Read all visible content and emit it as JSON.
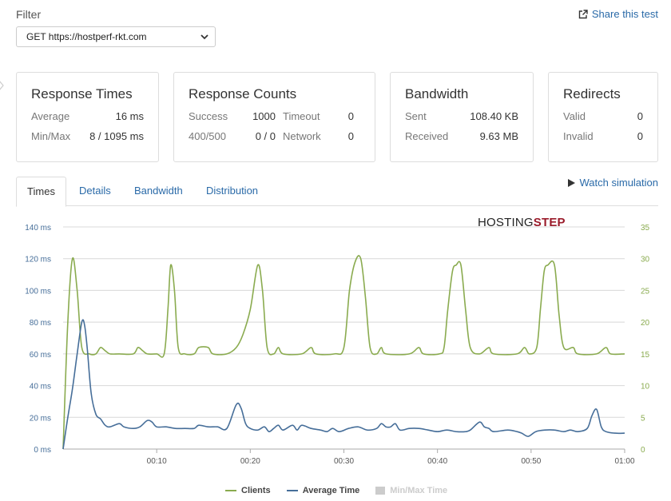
{
  "filter": {
    "label": "Filter",
    "selected": "GET https://hostperf-rkt.com"
  },
  "share_link": "Share this test",
  "cards": {
    "response_times": {
      "title": "Response Times",
      "average_label": "Average",
      "average_value": "16 ms",
      "minmax_label": "Min/Max",
      "minmax_value": "8 / 1095 ms"
    },
    "response_counts": {
      "title": "Response Counts",
      "success_label": "Success",
      "success_value": "1000",
      "timeout_label": "Timeout",
      "timeout_value": "0",
      "err_label": "400/500",
      "err_value": "0 / 0",
      "network_label": "Network",
      "network_value": "0"
    },
    "bandwidth": {
      "title": "Bandwidth",
      "sent_label": "Sent",
      "sent_value": "108.40 KB",
      "received_label": "Received",
      "received_value": "9.63 MB"
    },
    "redirects": {
      "title": "Redirects",
      "valid_label": "Valid",
      "valid_value": "0",
      "invalid_label": "Invalid",
      "invalid_value": "0"
    }
  },
  "tabs": [
    "Times",
    "Details",
    "Bandwidth",
    "Distribution"
  ],
  "watch_simulation": "Watch simulation",
  "logo": {
    "part1": "HOSTING",
    "part2": "STEP"
  },
  "colors": {
    "clients": "#8aab4f",
    "average": "#466e99",
    "minmax": "#cccccc",
    "link": "#2a6aa8"
  },
  "chart_data": {
    "type": "line",
    "x_ticks": [
      "00:10",
      "00:20",
      "00:30",
      "00:40",
      "00:50",
      "01:00"
    ],
    "y_left_ticks": [
      "0 ms",
      "20 ms",
      "40 ms",
      "60 ms",
      "80 ms",
      "100 ms",
      "120 ms",
      "140 ms"
    ],
    "y_right_ticks": [
      "0",
      "5",
      "10",
      "15",
      "20",
      "25",
      "30",
      "35"
    ],
    "xlim_seconds": [
      0,
      60
    ],
    "y_left_lim": [
      0,
      140
    ],
    "y_right_lim": [
      0,
      35
    ],
    "grid": true,
    "legend_position": "bottom",
    "series": [
      {
        "name": "Clients",
        "axis": "right",
        "points": [
          [
            0,
            0
          ],
          [
            0.5,
            20
          ],
          [
            1,
            30
          ],
          [
            1.5,
            25
          ],
          [
            2,
            16
          ],
          [
            2.8,
            15
          ],
          [
            3.5,
            15
          ],
          [
            4,
            16
          ],
          [
            4.5,
            15.5
          ],
          [
            5,
            15
          ],
          [
            6,
            15
          ],
          [
            7.5,
            15
          ],
          [
            8,
            16
          ],
          [
            8.5,
            15.5
          ],
          [
            9,
            15
          ],
          [
            10,
            15
          ],
          [
            10.8,
            15
          ],
          [
            11.2,
            22
          ],
          [
            11.5,
            29
          ],
          [
            11.9,
            25
          ],
          [
            12.3,
            16
          ],
          [
            13,
            15
          ],
          [
            14,
            15
          ],
          [
            14.5,
            16
          ],
          [
            15.5,
            16
          ],
          [
            16,
            15
          ],
          [
            17.5,
            15
          ],
          [
            18.5,
            16
          ],
          [
            19.2,
            18
          ],
          [
            20,
            22
          ],
          [
            20.8,
            29
          ],
          [
            21.3,
            25
          ],
          [
            21.8,
            16
          ],
          [
            22.5,
            15
          ],
          [
            23,
            16
          ],
          [
            23.5,
            15
          ],
          [
            25.5,
            15
          ],
          [
            26.5,
            16
          ],
          [
            27,
            15
          ],
          [
            29,
            15
          ],
          [
            30,
            16
          ],
          [
            30.6,
            25
          ],
          [
            31.2,
            29.5
          ],
          [
            31.8,
            30
          ],
          [
            32.3,
            24
          ],
          [
            32.8,
            16
          ],
          [
            33.5,
            15
          ],
          [
            34,
            16
          ],
          [
            34.5,
            15
          ],
          [
            37,
            15
          ],
          [
            38,
            16
          ],
          [
            38.5,
            15
          ],
          [
            40.2,
            15
          ],
          [
            40.7,
            16
          ],
          [
            41.1,
            22
          ],
          [
            41.6,
            28
          ],
          [
            42,
            29
          ],
          [
            42.5,
            29
          ],
          [
            43,
            22
          ],
          [
            43.5,
            16
          ],
          [
            44.5,
            15
          ],
          [
            45.5,
            16
          ],
          [
            46,
            15
          ],
          [
            48.5,
            15
          ],
          [
            49.3,
            16
          ],
          [
            49.8,
            15
          ],
          [
            50.6,
            16
          ],
          [
            51,
            22
          ],
          [
            51.4,
            28
          ],
          [
            51.8,
            29
          ],
          [
            52.5,
            29
          ],
          [
            53,
            21
          ],
          [
            53.5,
            16
          ],
          [
            54.5,
            16
          ],
          [
            55,
            15
          ],
          [
            57,
            15
          ],
          [
            58,
            16
          ],
          [
            58.5,
            15
          ],
          [
            60,
            15
          ]
        ]
      },
      {
        "name": "Average Time",
        "axis": "left",
        "points": [
          [
            0,
            0
          ],
          [
            0.5,
            20
          ],
          [
            1,
            38
          ],
          [
            1.5,
            60
          ],
          [
            2,
            80
          ],
          [
            2.3,
            78
          ],
          [
            2.6,
            62
          ],
          [
            3,
            35
          ],
          [
            3.5,
            22
          ],
          [
            4,
            19
          ],
          [
            4.5,
            15
          ],
          [
            5,
            14
          ],
          [
            6,
            16
          ],
          [
            6.5,
            14
          ],
          [
            7.5,
            13
          ],
          [
            8.2,
            14
          ],
          [
            9,
            18
          ],
          [
            9.5,
            17
          ],
          [
            10,
            14
          ],
          [
            11,
            14
          ],
          [
            12,
            13
          ],
          [
            13,
            13
          ],
          [
            14,
            13
          ],
          [
            14.5,
            15
          ],
          [
            15.5,
            14
          ],
          [
            16.5,
            14
          ],
          [
            17.5,
            13
          ],
          [
            18.5,
            28
          ],
          [
            19,
            26
          ],
          [
            19.5,
            16
          ],
          [
            20,
            13
          ],
          [
            20.8,
            12
          ],
          [
            21.5,
            14
          ],
          [
            22,
            11
          ],
          [
            22.5,
            13
          ],
          [
            23,
            15
          ],
          [
            23.5,
            12
          ],
          [
            24.5,
            15
          ],
          [
            25,
            12
          ],
          [
            25.5,
            15
          ],
          [
            26.5,
            13
          ],
          [
            27.5,
            12
          ],
          [
            28.2,
            11
          ],
          [
            28.8,
            13
          ],
          [
            29.5,
            11
          ],
          [
            30.5,
            13
          ],
          [
            31.5,
            14
          ],
          [
            32.5,
            12
          ],
          [
            33.5,
            13
          ],
          [
            34,
            16
          ],
          [
            34.5,
            14
          ],
          [
            35,
            14
          ],
          [
            35.5,
            16
          ],
          [
            36,
            12
          ],
          [
            37,
            13
          ],
          [
            38,
            13
          ],
          [
            39,
            12
          ],
          [
            40,
            11
          ],
          [
            41,
            12
          ],
          [
            42,
            11
          ],
          [
            43,
            11
          ],
          [
            43.5,
            12
          ],
          [
            44.5,
            17
          ],
          [
            45,
            14
          ],
          [
            45.5,
            13
          ],
          [
            46,
            11
          ],
          [
            47.5,
            12
          ],
          [
            48.5,
            11
          ],
          [
            49,
            10
          ],
          [
            49.7,
            8
          ],
          [
            50.5,
            11
          ],
          [
            51.5,
            12
          ],
          [
            52.5,
            12
          ],
          [
            53.5,
            11
          ],
          [
            54.2,
            12
          ],
          [
            55,
            11
          ],
          [
            56,
            13
          ],
          [
            56.5,
            21
          ],
          [
            57,
            25
          ],
          [
            57.5,
            14
          ],
          [
            58,
            11
          ],
          [
            59,
            10
          ],
          [
            60,
            10
          ]
        ]
      },
      {
        "name": "Min/Max Time",
        "axis": "left",
        "points": []
      }
    ]
  }
}
